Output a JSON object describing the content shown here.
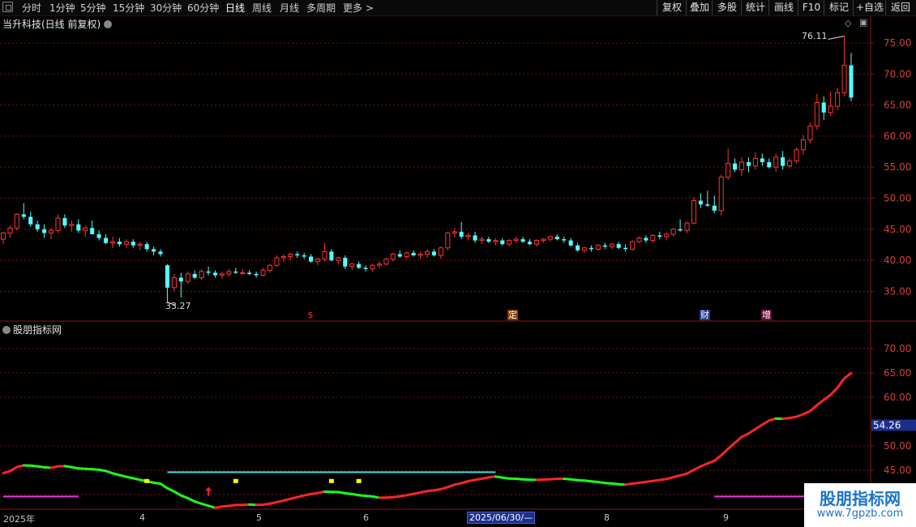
{
  "toolbar": {
    "periods": [
      "分时",
      "1分钟",
      "5分钟",
      "15分钟",
      "30分钟",
      "60分钟",
      "日线",
      "周线",
      "月线",
      "多周期",
      "更多 >"
    ],
    "active_period": "日线",
    "right_buttons": [
      "复权",
      "叠加",
      "多股",
      "统计",
      "画线",
      "F10",
      "标记",
      "+自选",
      "返回"
    ]
  },
  "stock": {
    "title": "当升科技(日线 前复权)"
  },
  "indicator": {
    "title": "股朋指标网",
    "current_value_label": "54.26"
  },
  "price_axis": {
    "ticks": [
      "75.00",
      "70.00",
      "65.00",
      "60.00",
      "55.00",
      "50.00",
      "45.00",
      "40.00",
      "35.00"
    ]
  },
  "indicator_axis": {
    "ticks": [
      "70.00",
      "65.00",
      "60.00",
      "50.00",
      "45.00",
      "40.00"
    ]
  },
  "annotations": {
    "high_label": "76.11",
    "low_label": "33.27"
  },
  "event_badges": [
    {
      "text": "$",
      "color": "#d01818"
    },
    {
      "text": "定",
      "color": "#d05a10"
    },
    {
      "text": "财",
      "color": "#1d4bb8"
    },
    {
      "text": "增",
      "color": "#c01080"
    }
  ],
  "x_axis": {
    "labels": [
      "2025年",
      "4",
      "5",
      "6",
      "8",
      "9"
    ],
    "cursor_date": "2025/06/30/—"
  },
  "watermark": {
    "title": "股朋指标网",
    "url": "www.7gpzb.com"
  },
  "colors": {
    "up": "#ff3333",
    "down": "#54ffff",
    "grid": "#7a1010",
    "axis": "#8a1818",
    "line_red": "#ff2424",
    "line_green": "#1aff1a",
    "line_cyan": "#33e6e6",
    "line_magenta": "#e53ae5"
  },
  "chart_data": {
    "type": "candlestick",
    "price_ylim": [
      31,
      78
    ],
    "high": 76.11,
    "low": 33.27,
    "ohlc": [
      [
        43.4,
        44.6,
        42.6,
        44.4
      ],
      [
        44.4,
        45.6,
        43.6,
        45.2
      ],
      [
        45.2,
        47.6,
        44.8,
        47.4
      ],
      [
        47.4,
        49.2,
        46.6,
        47.0
      ],
      [
        47.0,
        47.8,
        45.4,
        45.8
      ],
      [
        45.8,
        46.4,
        44.6,
        45.0
      ],
      [
        45.0,
        45.8,
        43.6,
        44.4
      ],
      [
        44.4,
        45.2,
        43.4,
        44.8
      ],
      [
        44.8,
        47.4,
        44.4,
        46.8
      ],
      [
        46.8,
        47.4,
        45.2,
        45.6
      ],
      [
        45.6,
        46.4,
        44.6,
        45.8
      ],
      [
        45.8,
        46.6,
        44.4,
        44.8
      ],
      [
        44.8,
        45.6,
        43.8,
        45.2
      ],
      [
        45.2,
        46.4,
        44.2,
        44.2
      ],
      [
        44.2,
        44.8,
        43.2,
        43.6
      ],
      [
        43.6,
        44.2,
        42.6,
        42.8
      ],
      [
        42.8,
        43.8,
        42.0,
        43.0
      ],
      [
        43.0,
        43.6,
        42.2,
        42.6
      ],
      [
        42.6,
        43.4,
        42.0,
        43.0
      ],
      [
        43.0,
        43.4,
        42.0,
        42.4
      ],
      [
        42.4,
        43.0,
        41.6,
        42.6
      ],
      [
        42.6,
        43.0,
        41.4,
        41.8
      ],
      [
        41.8,
        42.2,
        40.8,
        41.4
      ],
      [
        41.4,
        41.8,
        40.6,
        41.0
      ],
      [
        39.2,
        39.4,
        33.27,
        35.6
      ],
      [
        35.6,
        37.8,
        35.0,
        37.2
      ],
      [
        37.2,
        38.0,
        34.0,
        36.6
      ],
      [
        36.6,
        38.2,
        36.2,
        37.8
      ],
      [
        37.8,
        38.4,
        37.0,
        37.2
      ],
      [
        37.2,
        38.6,
        36.8,
        38.2
      ],
      [
        38.2,
        39.0,
        37.6,
        38.0
      ],
      [
        38.0,
        38.4,
        37.2,
        37.6
      ],
      [
        37.6,
        38.2,
        37.0,
        37.8
      ],
      [
        37.8,
        38.6,
        37.4,
        38.2
      ],
      [
        38.2,
        38.8,
        37.8,
        38.0
      ],
      [
        38.0,
        38.6,
        37.6,
        38.0
      ],
      [
        38.0,
        38.4,
        37.6,
        37.8
      ],
      [
        37.8,
        38.2,
        37.2,
        37.6
      ],
      [
        37.6,
        38.8,
        37.4,
        38.4
      ],
      [
        38.4,
        39.4,
        38.0,
        39.2
      ],
      [
        39.2,
        40.8,
        39.0,
        40.4
      ],
      [
        40.4,
        41.0,
        39.8,
        40.6
      ],
      [
        40.6,
        41.2,
        40.0,
        41.0
      ],
      [
        41.0,
        41.4,
        40.4,
        40.8
      ],
      [
        40.8,
        41.2,
        40.2,
        40.6
      ],
      [
        40.6,
        41.0,
        39.6,
        39.8
      ],
      [
        39.8,
        40.4,
        39.2,
        40.2
      ],
      [
        40.2,
        42.8,
        39.8,
        41.4
      ],
      [
        41.4,
        41.8,
        39.8,
        40.0
      ],
      [
        40.0,
        40.6,
        39.4,
        40.4
      ],
      [
        40.4,
        40.8,
        38.6,
        39.0
      ],
      [
        39.0,
        39.6,
        38.4,
        39.4
      ],
      [
        39.4,
        39.8,
        38.6,
        38.8
      ],
      [
        38.8,
        39.2,
        38.2,
        38.6
      ],
      [
        38.6,
        39.4,
        38.2,
        39.2
      ],
      [
        39.2,
        39.8,
        38.8,
        39.4
      ],
      [
        39.4,
        40.4,
        39.2,
        40.2
      ],
      [
        40.2,
        41.2,
        39.8,
        41.0
      ],
      [
        41.0,
        41.6,
        40.4,
        40.6
      ],
      [
        40.6,
        41.4,
        40.2,
        41.2
      ],
      [
        41.2,
        41.6,
        40.6,
        40.8
      ],
      [
        40.8,
        41.4,
        40.2,
        41.0
      ],
      [
        41.0,
        41.8,
        40.4,
        41.4
      ],
      [
        41.4,
        41.8,
        40.6,
        40.8
      ],
      [
        40.8,
        42.2,
        40.2,
        42.0
      ],
      [
        42.0,
        44.6,
        41.6,
        44.4
      ],
      [
        44.4,
        45.2,
        43.8,
        44.6
      ],
      [
        44.6,
        46.2,
        43.4,
        43.8
      ],
      [
        43.8,
        44.4,
        43.2,
        44.0
      ],
      [
        44.0,
        44.6,
        42.8,
        43.2
      ],
      [
        43.2,
        43.8,
        42.6,
        43.4
      ],
      [
        43.4,
        43.8,
        42.8,
        43.0
      ],
      [
        43.0,
        43.6,
        42.4,
        43.2
      ],
      [
        43.2,
        43.6,
        42.4,
        42.6
      ],
      [
        42.6,
        43.4,
        42.2,
        43.2
      ],
      [
        43.2,
        43.8,
        42.8,
        43.4
      ],
      [
        43.4,
        43.8,
        42.8,
        43.0
      ],
      [
        43.0,
        43.4,
        42.4,
        42.6
      ],
      [
        42.6,
        43.4,
        42.2,
        43.2
      ],
      [
        43.2,
        43.6,
        42.8,
        43.4
      ],
      [
        43.4,
        44.0,
        43.0,
        43.8
      ],
      [
        43.8,
        44.2,
        43.2,
        43.4
      ],
      [
        43.4,
        43.8,
        42.8,
        43.2
      ],
      [
        43.2,
        43.6,
        42.2,
        42.4
      ],
      [
        42.4,
        42.8,
        41.4,
        41.6
      ],
      [
        41.6,
        42.2,
        41.2,
        42.0
      ],
      [
        42.0,
        42.4,
        41.4,
        41.8
      ],
      [
        41.8,
        42.6,
        41.6,
        42.4
      ],
      [
        42.4,
        42.8,
        41.8,
        42.2
      ],
      [
        42.2,
        42.8,
        41.8,
        42.6
      ],
      [
        42.6,
        43.0,
        41.8,
        42.0
      ],
      [
        42.0,
        42.6,
        41.4,
        41.8
      ],
      [
        41.8,
        43.2,
        41.6,
        43.0
      ],
      [
        43.0,
        43.8,
        42.8,
        43.6
      ],
      [
        43.6,
        44.0,
        42.8,
        43.2
      ],
      [
        43.2,
        44.2,
        42.8,
        44.0
      ],
      [
        44.0,
        44.6,
        43.4,
        43.8
      ],
      [
        43.8,
        44.4,
        43.2,
        44.2
      ],
      [
        44.2,
        45.2,
        43.8,
        45.0
      ],
      [
        45.0,
        46.6,
        44.6,
        44.8
      ],
      [
        44.8,
        46.2,
        44.4,
        46.0
      ],
      [
        46.0,
        50.2,
        45.8,
        49.6
      ],
      [
        49.6,
        50.8,
        48.4,
        49.0
      ],
      [
        49.0,
        51.2,
        48.6,
        48.8
      ],
      [
        48.8,
        50.4,
        47.6,
        48.0
      ],
      [
        48.0,
        53.8,
        47.2,
        53.4
      ],
      [
        53.4,
        58.0,
        53.0,
        55.6
      ],
      [
        55.6,
        56.4,
        54.2,
        54.6
      ],
      [
        54.6,
        56.6,
        53.6,
        55.8
      ],
      [
        55.8,
        56.6,
        54.2,
        55.2
      ],
      [
        55.2,
        57.4,
        54.6,
        56.4
      ],
      [
        56.4,
        57.2,
        55.2,
        55.8
      ],
      [
        55.8,
        56.4,
        54.8,
        55.0
      ],
      [
        55.0,
        57.2,
        54.2,
        56.6
      ],
      [
        56.6,
        57.6,
        54.6,
        55.2
      ],
      [
        55.2,
        56.4,
        54.8,
        56.0
      ],
      [
        56.0,
        58.2,
        55.6,
        57.8
      ],
      [
        57.8,
        60.2,
        57.0,
        59.4
      ],
      [
        59.4,
        62.2,
        58.8,
        61.6
      ],
      [
        61.6,
        66.8,
        61.0,
        65.4
      ],
      [
        65.4,
        66.4,
        62.6,
        63.8
      ],
      [
        63.8,
        67.2,
        63.2,
        64.8
      ],
      [
        64.8,
        67.8,
        64.2,
        67.0
      ],
      [
        67.0,
        76.11,
        66.4,
        71.4
      ],
      [
        71.4,
        73.4,
        65.6,
        66.2
      ]
    ],
    "event_bars": [
      21,
      34,
      48,
      52
    ]
  }
}
